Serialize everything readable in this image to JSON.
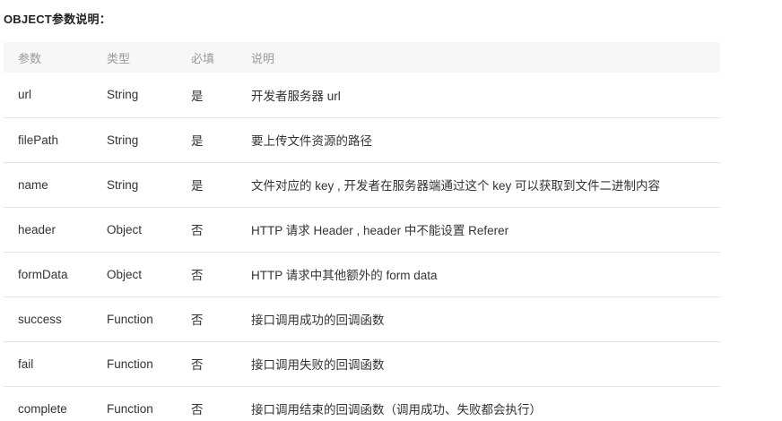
{
  "section_title": "OBJECT参数说明：",
  "table": {
    "headers": [
      "参数",
      "类型",
      "必填",
      "说明"
    ],
    "rows": [
      {
        "name": "url",
        "type": "String",
        "required": "是",
        "desc": "开发者服务器 url"
      },
      {
        "name": "filePath",
        "type": "String",
        "required": "是",
        "desc": "要上传文件资源的路径"
      },
      {
        "name": "name",
        "type": "String",
        "required": "是",
        "desc": "文件对应的 key , 开发者在服务器端通过这个 key 可以获取到文件二进制内容"
      },
      {
        "name": "header",
        "type": "Object",
        "required": "否",
        "desc": "HTTP 请求 Header , header 中不能设置 Referer"
      },
      {
        "name": "formData",
        "type": "Object",
        "required": "否",
        "desc": "HTTP 请求中其他额外的 form data"
      },
      {
        "name": "success",
        "type": "Function",
        "required": "否",
        "desc": "接口调用成功的回调函数"
      },
      {
        "name": "fail",
        "type": "Function",
        "required": "否",
        "desc": "接口调用失败的回调函数"
      },
      {
        "name": "complete",
        "type": "Function",
        "required": "否",
        "desc": "接口调用结束的回调函数（调用成功、失败都会执行）"
      }
    ]
  }
}
